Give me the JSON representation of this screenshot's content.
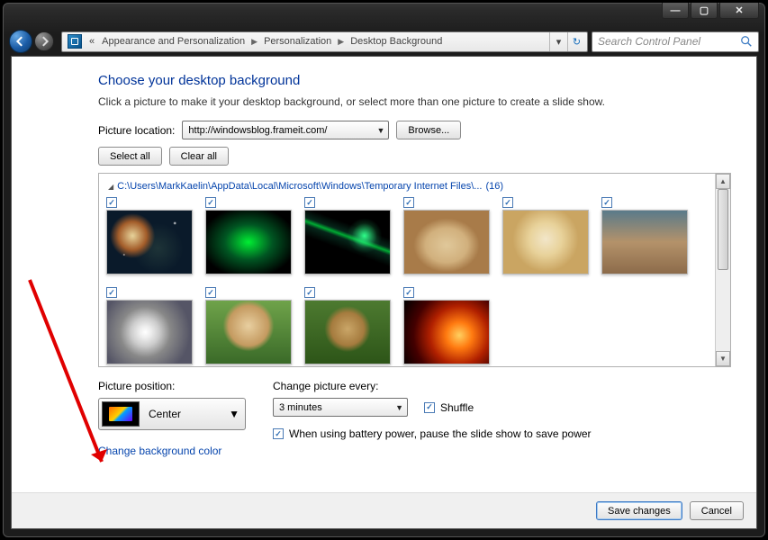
{
  "window": {
    "min": "—",
    "max": "▢",
    "close": "✕"
  },
  "breadcrumbs": {
    "lead": "«",
    "items": [
      "Appearance and Personalization",
      "Personalization",
      "Desktop Background"
    ]
  },
  "search": {
    "placeholder": "Search Control Panel"
  },
  "page": {
    "title": "Choose your desktop background",
    "instruction": "Click a picture to make it your desktop background, or select more than one picture to create a slide show."
  },
  "location": {
    "label": "Picture location:",
    "value": "http://windowsblog.frameit.com/",
    "browse": "Browse..."
  },
  "select_all": "Select all",
  "clear_all": "Clear all",
  "gallery": {
    "path": "C:\\Users\\MarkKaelin\\AppData\\Local\\Microsoft\\Windows\\Temporary Internet Files\\...",
    "count": "(16)"
  },
  "position": {
    "label": "Picture position:",
    "value": "Center"
  },
  "change_every": {
    "label": "Change picture every:",
    "value": "3 minutes"
  },
  "shuffle": "Shuffle",
  "battery": "When using battery power, pause the slide show to save power",
  "bg_link": "Change background color",
  "footer": {
    "save": "Save changes",
    "cancel": "Cancel"
  }
}
